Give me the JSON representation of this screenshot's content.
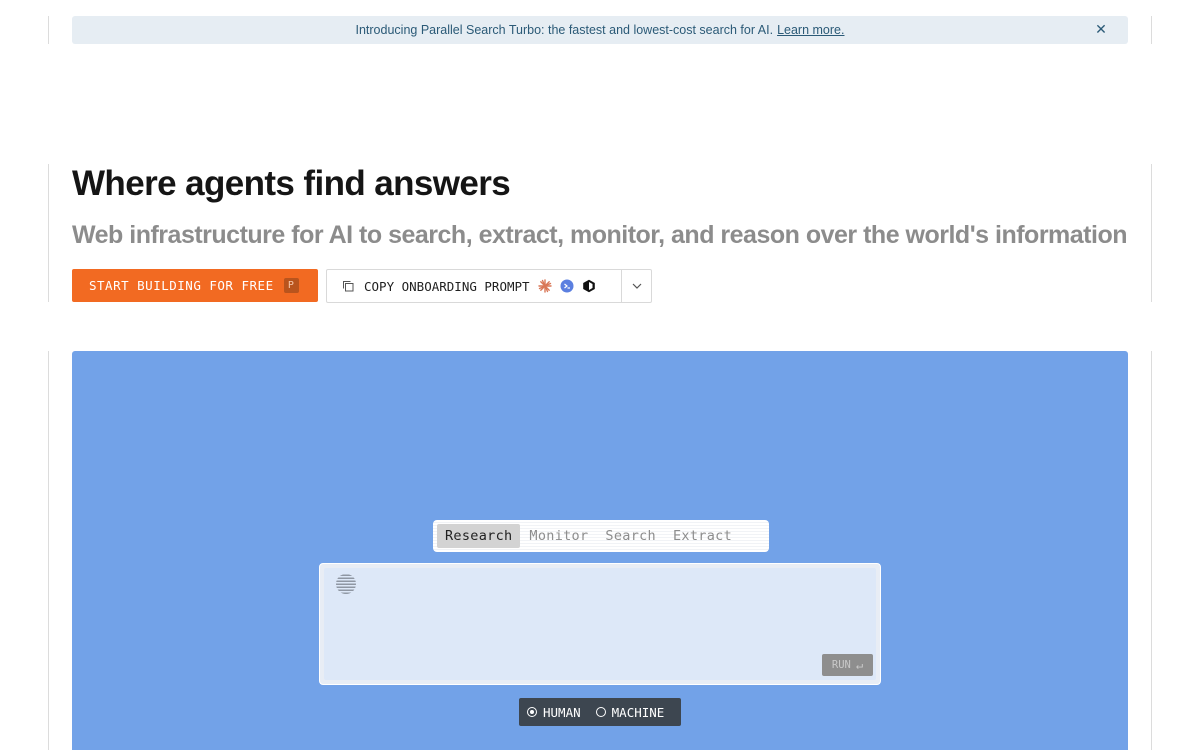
{
  "banner": {
    "text": "Introducing Parallel Search Turbo: the fastest and lowest-cost search for AI.",
    "link": "Learn more.",
    "close_icon": "close-icon"
  },
  "hero": {
    "title": "Where agents find answers",
    "subtitle": "Web infrastructure for AI to search, extract, monitor, and reason over the world's information"
  },
  "cta": {
    "primary_label": "START BUILDING FOR FREE",
    "primary_shortcut": "P",
    "copy_label": "COPY ONBOARDING PROMPT",
    "icons": [
      "copy-icon",
      "claude-icon",
      "gemini-icon",
      "cursor-icon",
      "chevron-down-icon"
    ]
  },
  "demo": {
    "tabs": [
      {
        "label": "Research",
        "active": true
      },
      {
        "label": "Monitor",
        "active": false
      },
      {
        "label": "Search",
        "active": false
      },
      {
        "label": "Extract",
        "active": false
      }
    ],
    "run_label": "RUN",
    "run_icon": "↵",
    "modes": [
      {
        "label": "HUMAN",
        "selected": true
      },
      {
        "label": "MACHINE",
        "selected": false
      }
    ]
  },
  "colors": {
    "accent": "#f26a22",
    "demo_bg": "#72a2e8",
    "banner_bg": "#e6edf3"
  }
}
